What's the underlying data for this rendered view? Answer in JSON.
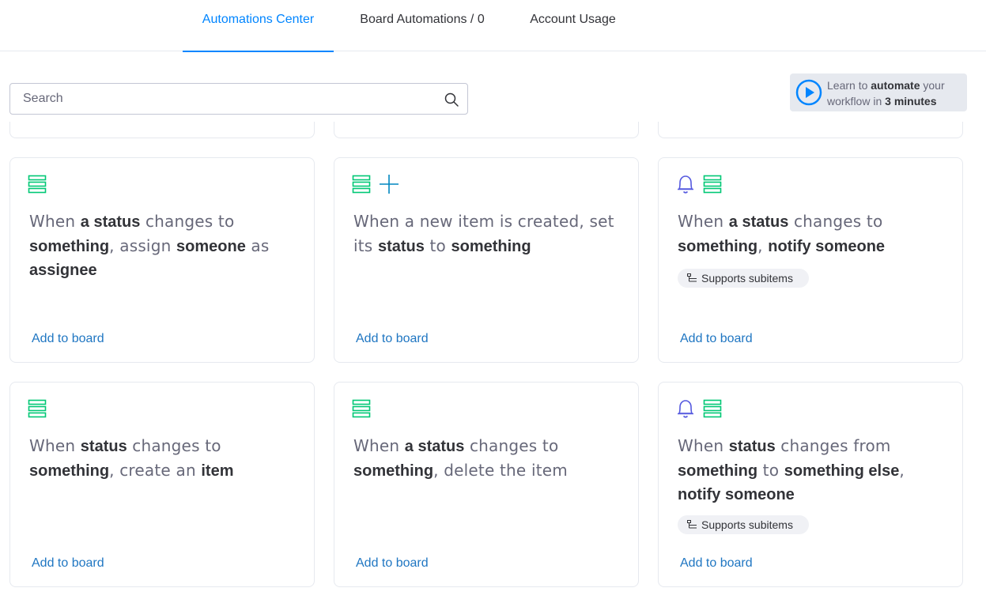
{
  "tabs": [
    {
      "label": "Automations Center",
      "active": true
    },
    {
      "label": "Board Automations / 0",
      "active": false
    },
    {
      "label": "Account Usage",
      "active": false
    }
  ],
  "search": {
    "placeholder": "Search",
    "value": ""
  },
  "learn": {
    "prefix": "Learn to ",
    "bold1": "automate",
    "mid": " your",
    "line2": "workflow in ",
    "bold2": "3 minutes"
  },
  "badge_label": "Supports subitems",
  "add_label": "Add to board",
  "colors": {
    "accent": "#0085ff",
    "link": "#1f76c2",
    "item_icon": "#00c875",
    "bell_icon": "#5559df",
    "plus_icon": "#0086c0"
  },
  "cards": [
    {
      "icons": [
        "item-icon"
      ],
      "segments": [
        [
          "When ",
          false
        ],
        [
          "a status",
          true
        ],
        [
          " changes to ",
          false
        ],
        [
          "something",
          true
        ],
        [
          ", assign ",
          false
        ],
        [
          "someone",
          true
        ],
        [
          " as ",
          false
        ],
        [
          "assignee",
          true
        ]
      ],
      "badge": false
    },
    {
      "icons": [
        "item-icon",
        "plus-icon"
      ],
      "segments": [
        [
          "When a new item is created, set its ",
          false
        ],
        [
          "status",
          true
        ],
        [
          " to ",
          false
        ],
        [
          "something",
          true
        ]
      ],
      "badge": false
    },
    {
      "icons": [
        "bell-icon",
        "item-icon"
      ],
      "segments": [
        [
          "When ",
          false
        ],
        [
          "a status",
          true
        ],
        [
          " changes to ",
          false
        ],
        [
          "something",
          true
        ],
        [
          ", ",
          false
        ],
        [
          "notify someone",
          true
        ]
      ],
      "badge": true
    },
    {
      "icons": [
        "item-icon"
      ],
      "segments": [
        [
          "When ",
          false
        ],
        [
          "status",
          true
        ],
        [
          " changes to ",
          false
        ],
        [
          "something",
          true
        ],
        [
          ", create an ",
          false
        ],
        [
          "item",
          true
        ]
      ],
      "badge": false
    },
    {
      "icons": [
        "item-icon"
      ],
      "segments": [
        [
          "When ",
          false
        ],
        [
          "a status",
          true
        ],
        [
          " changes to ",
          false
        ],
        [
          "something",
          true
        ],
        [
          ", delete the item",
          false
        ]
      ],
      "badge": false
    },
    {
      "icons": [
        "bell-icon",
        "item-icon"
      ],
      "segments": [
        [
          "When ",
          false
        ],
        [
          "status",
          true
        ],
        [
          " changes from ",
          false
        ],
        [
          "something",
          true
        ],
        [
          " to ",
          false
        ],
        [
          "something else",
          true
        ],
        [
          ", ",
          false
        ],
        [
          "notify someone",
          true
        ]
      ],
      "badge": true
    }
  ]
}
